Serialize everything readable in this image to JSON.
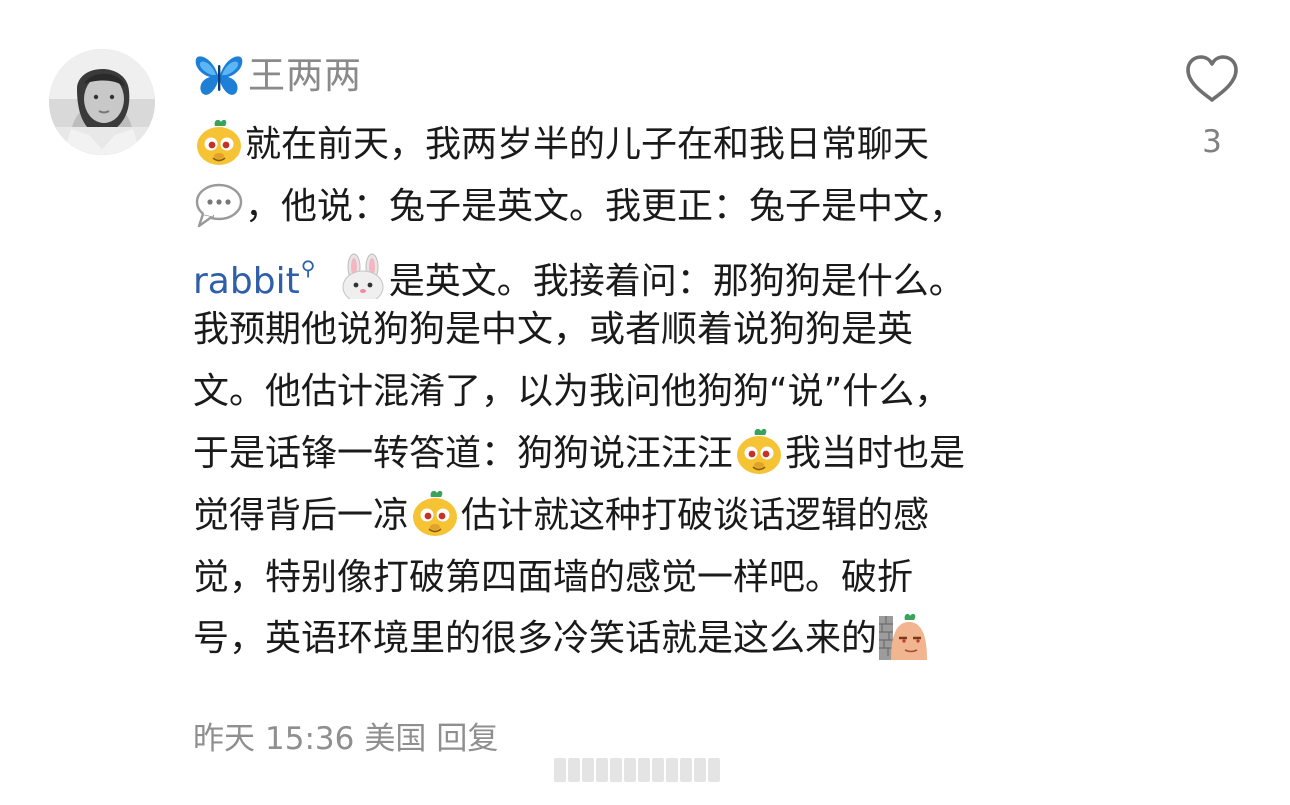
{
  "comment": {
    "author": {
      "name": "王两两",
      "name_badge_icon": "butterfly-icon",
      "avatar_icon": "avatar-photo"
    },
    "like": {
      "icon": "heart-outline-icon",
      "count": "3"
    },
    "body": {
      "line1": "就在前天，我两岁半的儿子在和我日常聊天",
      "line2": "，他说：兔子是英文。我更正：兔子是中文，",
      "line3_link": "rabbit",
      "line3_link_icon": "search-link-icon",
      "line3_rest": "是英文。我接着问：那狗狗是什么。",
      "line4": "我预期他说狗狗是中文，或者顺着说狗狗是英",
      "line5": "文。他估计混淆了，以为我问他狗狗“说”什么，",
      "line6_a": "于是话锋一转答道：狗狗说汪汪汪",
      "line6_b": "我当时也是",
      "line7_a": "觉得背后一凉",
      "line7_b": "估计就这种打破谈话逻辑的感",
      "line8": "觉，特别像打破第四面墙的感觉一样吧。破折",
      "line9": "号，英语环境里的很多冷笑话就是这么来的",
      "emoji_names": [
        "doge-face-emoji",
        "speech-bubble-emoji",
        "bunny-face-emoji",
        "peek-wall-emoji"
      ]
    },
    "meta": {
      "date": "昨天",
      "time": "15:36",
      "location": "美国",
      "reply_label": "回复"
    }
  },
  "colors": {
    "username": "#8a8a8a",
    "text": "#1a1a1a",
    "link": "#2f5fa8",
    "meta": "#8f8f8f",
    "like_icon": "#6f6f6f"
  }
}
